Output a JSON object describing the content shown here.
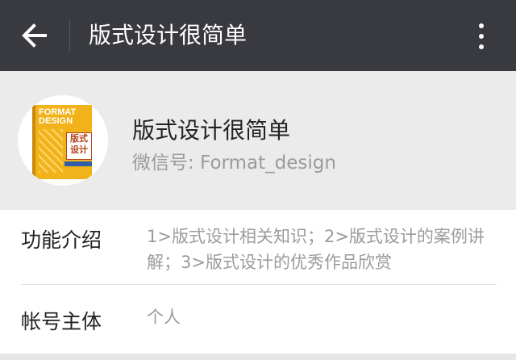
{
  "topbar": {
    "title": "版式设计很简单",
    "back_icon": "arrow-left-icon",
    "more_icon": "more-vertical-icon"
  },
  "profile": {
    "name": "版式设计很简单",
    "wechat_id": "微信号: Format_design",
    "avatar": {
      "cover_title": "FORMAT DESIGN",
      "cover_cn": "版式设计"
    }
  },
  "info": {
    "function_label": "功能介绍",
    "function_value": "1>版式设计相关知识；2>版式设计的案例讲解；3>版式设计的优秀作品欣赏",
    "owner_label": "帐号主体",
    "owner_value": "个人"
  },
  "colors": {
    "topbar": "#393a3f",
    "profile_bg": "#ebebeb",
    "book": "#f2b21a"
  }
}
